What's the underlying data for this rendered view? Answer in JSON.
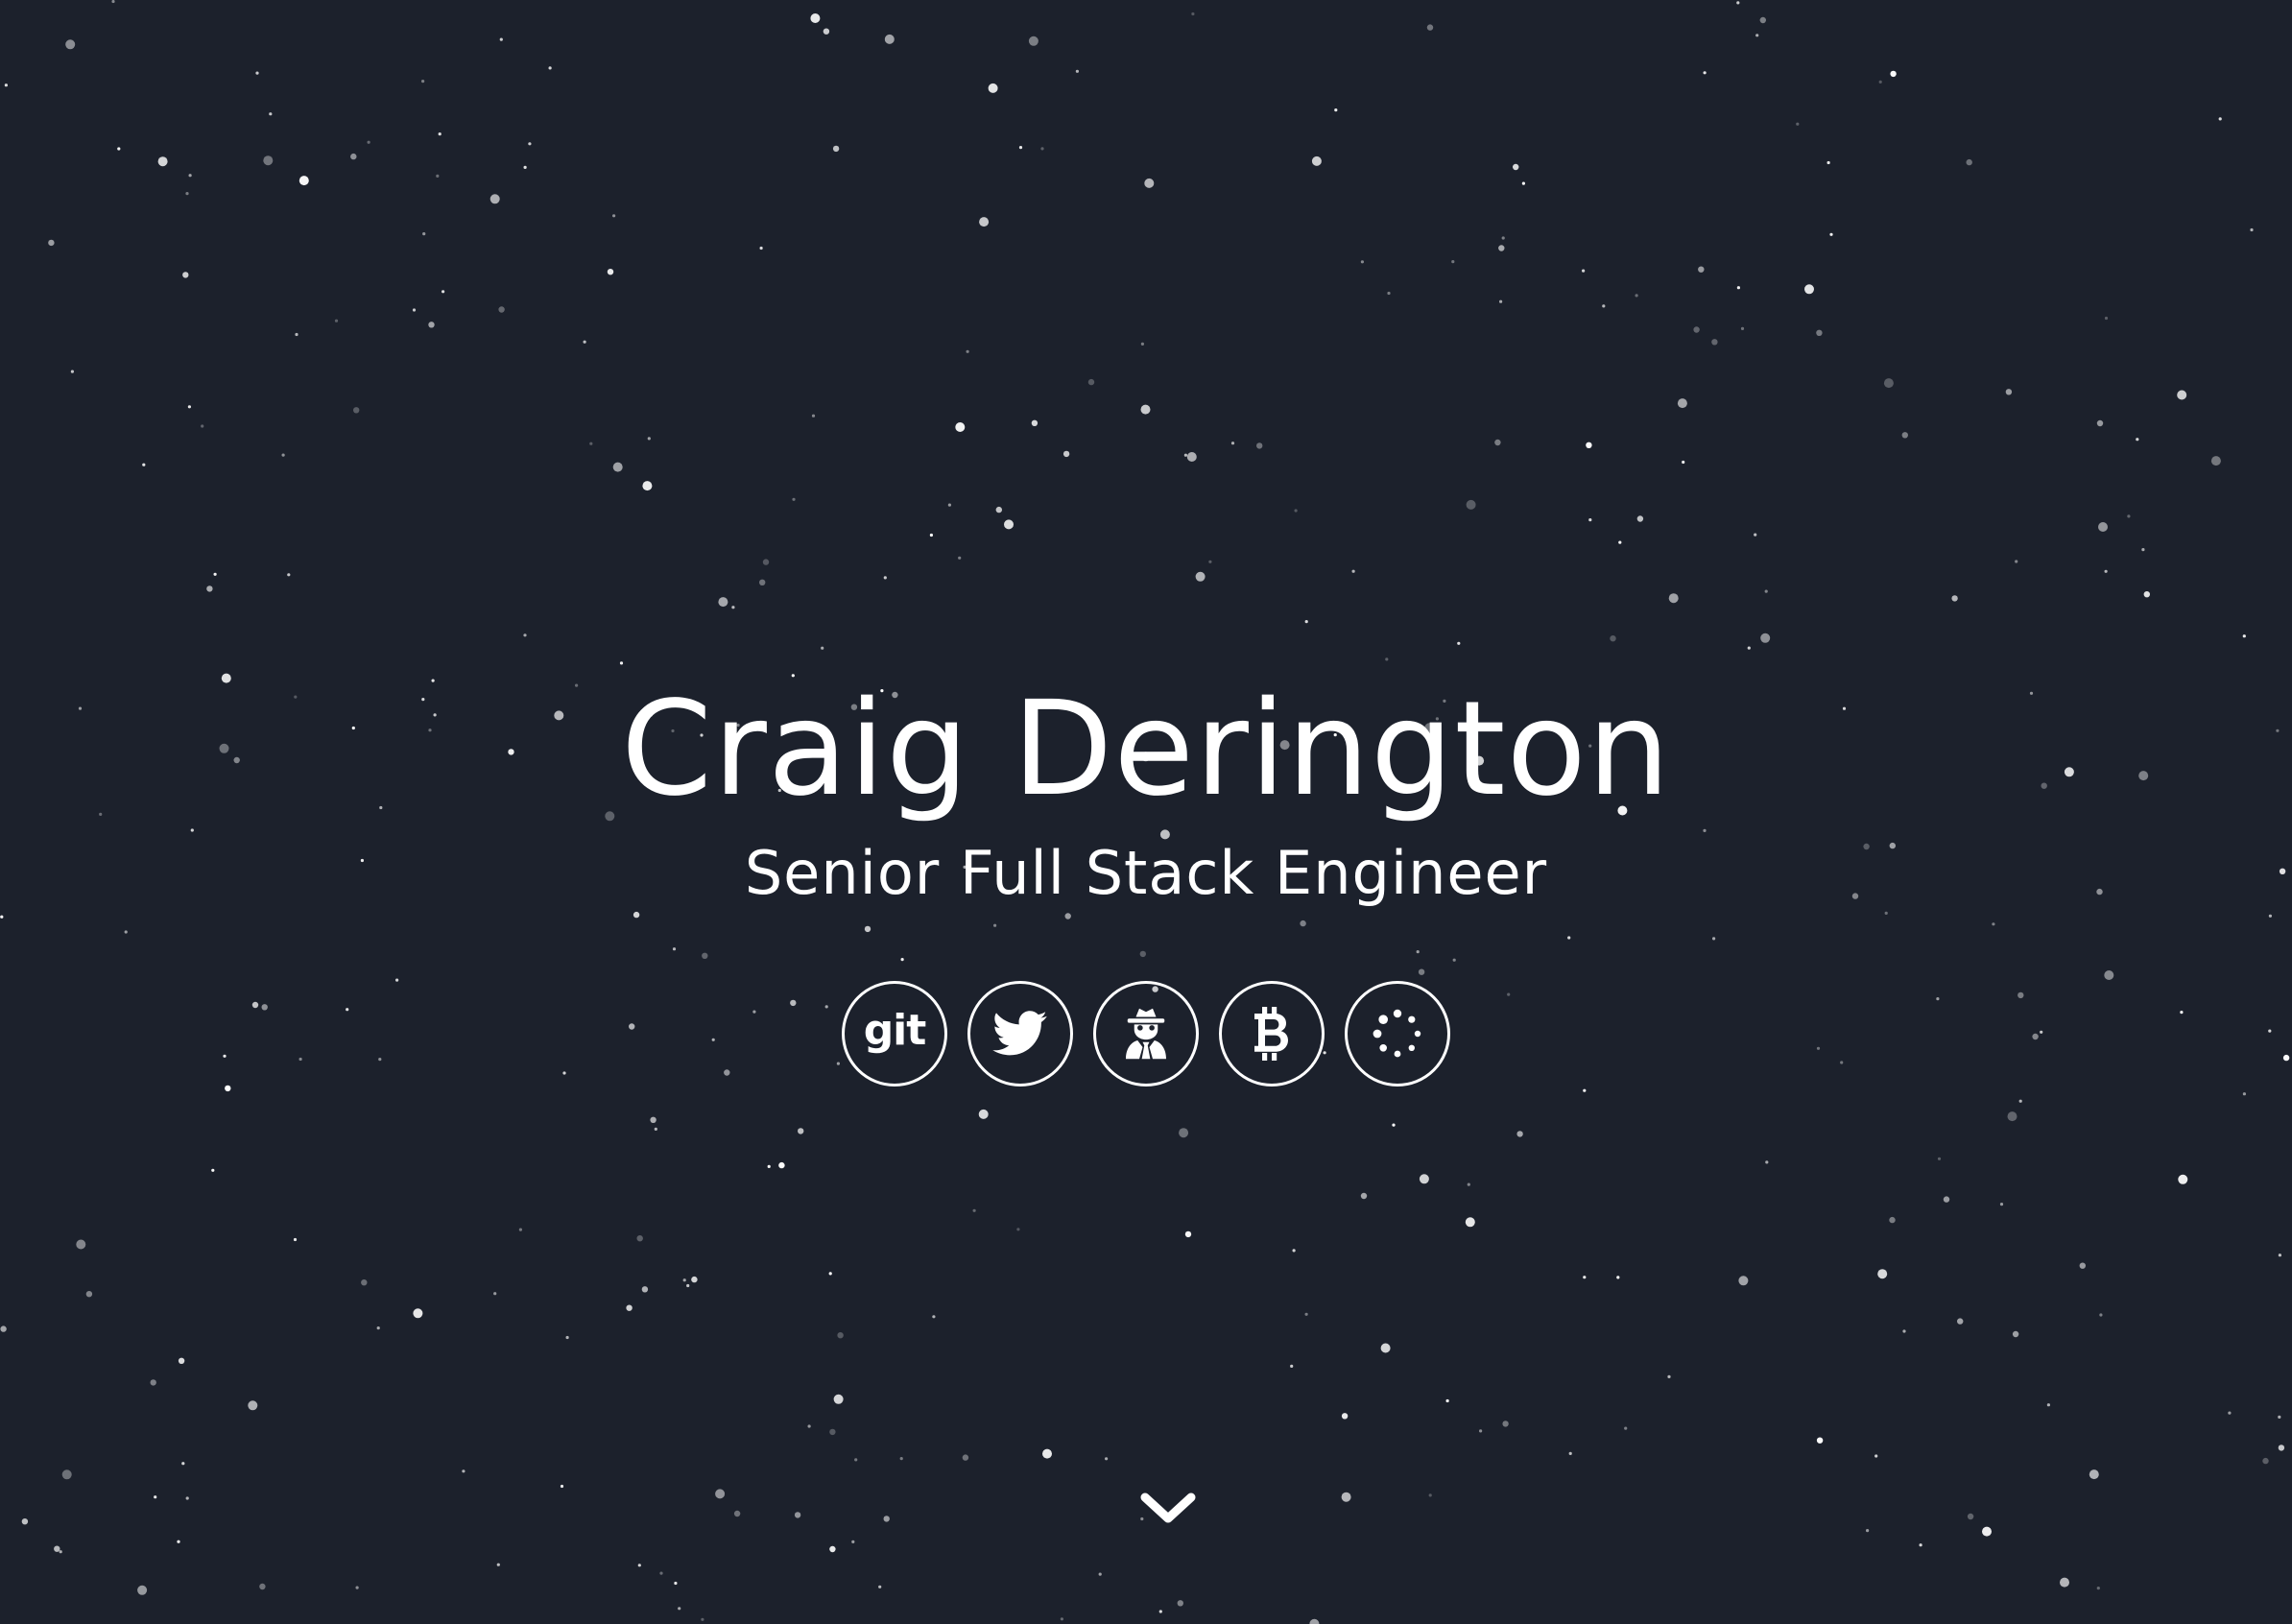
{
  "hero": {
    "name": "Craig Derington",
    "title": "Senior Full Stack Engineer"
  },
  "social_links": [
    {
      "id": "git",
      "label": "git",
      "icon": "git-icon"
    },
    {
      "id": "twitter",
      "icon": "twitter-icon"
    },
    {
      "id": "hacker",
      "icon": "user-secret-icon"
    },
    {
      "id": "bitcoin",
      "icon": "bitcoin-icon"
    },
    {
      "id": "circle-notch",
      "icon": "spinner-dots-icon"
    }
  ],
  "scroll_indicator": {
    "icon": "chevron-down-icon"
  },
  "colors": {
    "background": "#1c212c",
    "foreground": "#ffffff"
  }
}
